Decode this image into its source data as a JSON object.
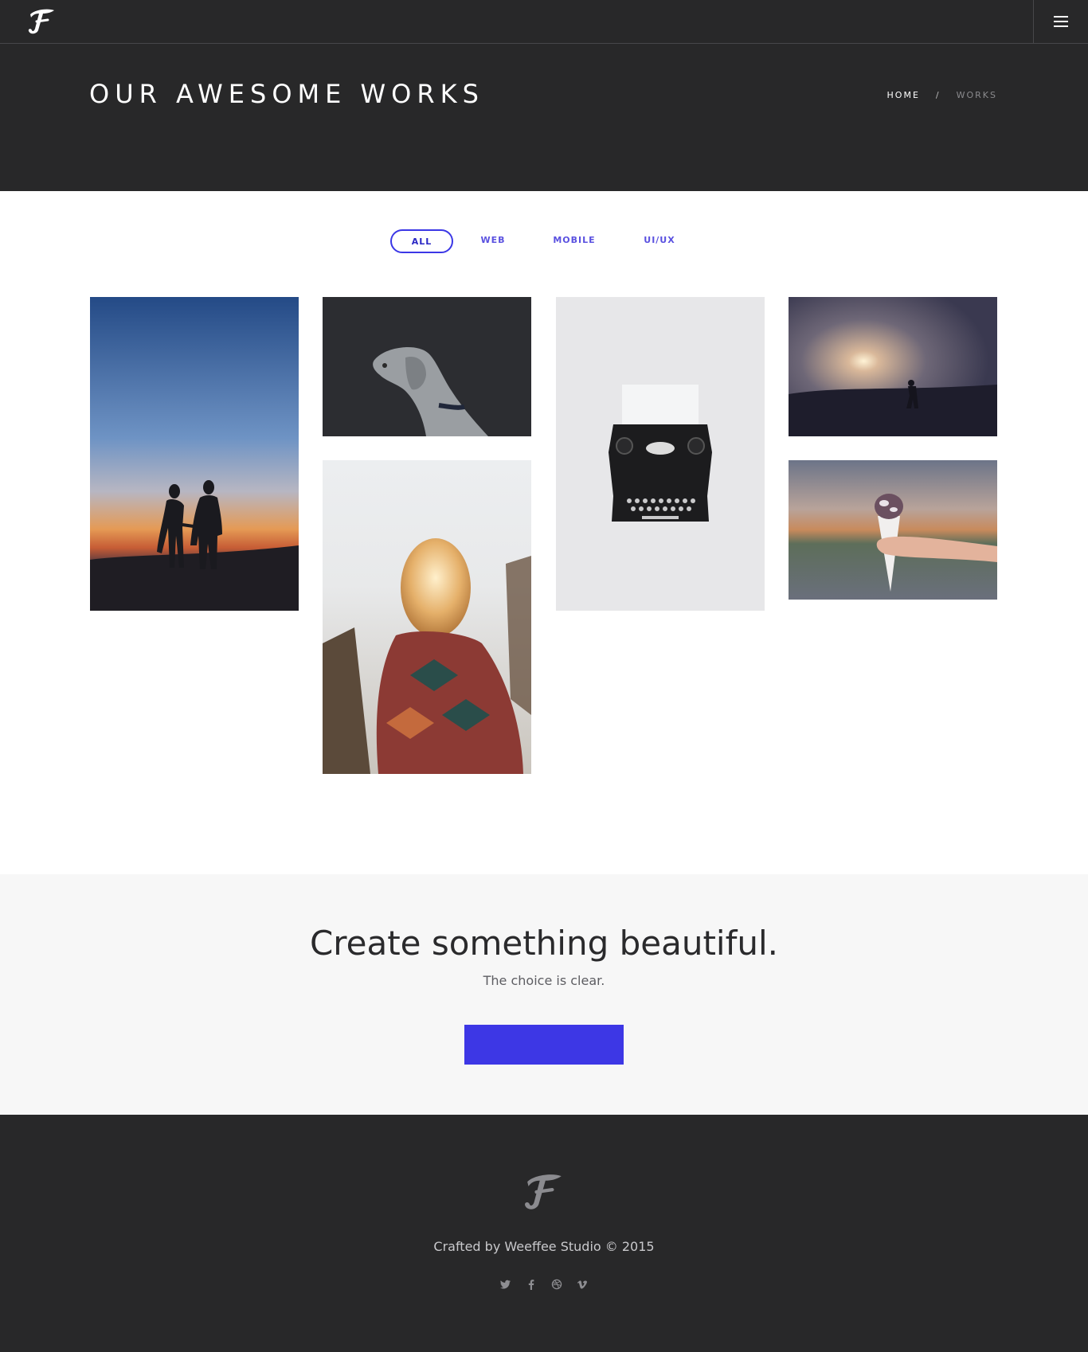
{
  "header": {
    "logo_alt": "F",
    "menu_icon": "hamburger-menu-icon"
  },
  "hero": {
    "title": "OUR AWESOME WORKS",
    "breadcrumb": {
      "home": "HOME",
      "separator": "/",
      "current": "WORKS"
    }
  },
  "filters": [
    {
      "label": "ALL",
      "active": true
    },
    {
      "label": "WEB",
      "active": false
    },
    {
      "label": "MOBILE",
      "active": false
    },
    {
      "label": "UI/UX",
      "active": false
    }
  ],
  "portfolio": [
    {
      "subject": "couple-silhouette-sunset"
    },
    {
      "subject": "dog-portrait-dark"
    },
    {
      "subject": "typewriter-top-view"
    },
    {
      "subject": "foggy-sunrise-figure"
    },
    {
      "subject": "woman-blanket-backlit"
    },
    {
      "subject": "ice-cream-cone-hand"
    }
  ],
  "cta": {
    "title": "Create something beautiful.",
    "subtitle": "The choice is clear.",
    "button_label": ""
  },
  "footer": {
    "credit": "Crafted by Weeffee Studio © 2015",
    "socials": [
      "twitter-icon",
      "facebook-icon",
      "dribbble-icon",
      "vimeo-icon"
    ]
  },
  "colors": {
    "dark": "#282829",
    "accent": "#3d37e5",
    "cta_bg": "#f7f7f7"
  }
}
